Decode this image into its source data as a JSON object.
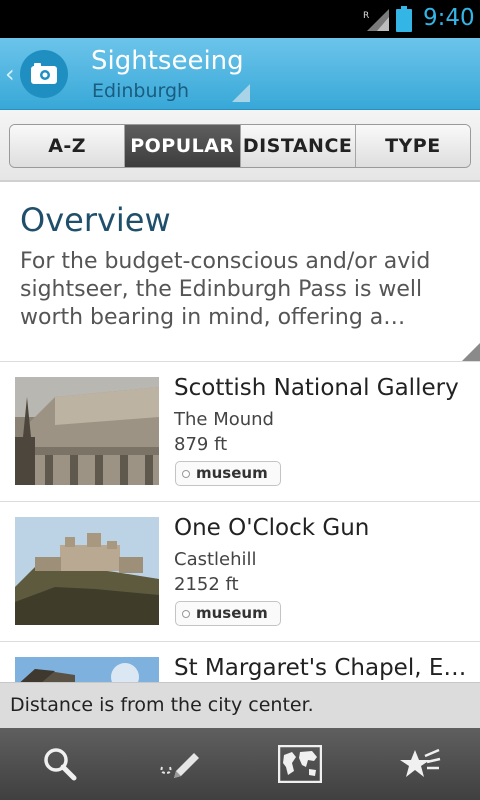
{
  "status_bar": {
    "time": "9:40",
    "signal_icon": "signal-roaming-icon",
    "battery_icon": "battery-icon"
  },
  "action_bar": {
    "title": "Sightseeing",
    "subtitle": "Edinburgh",
    "app_icon": "camera-icon",
    "accent_color": "#38a8d8"
  },
  "tabs": [
    {
      "label": "A-Z",
      "active": false
    },
    {
      "label": "POPULAR",
      "active": true
    },
    {
      "label": "DISTANCE",
      "active": false
    },
    {
      "label": "TYPE",
      "active": false
    }
  ],
  "overview": {
    "title": "Overview",
    "text": "For the budget-conscious and/or avid sightseer, the Edinburgh Pass is well worth bearing in mind, offering a…"
  },
  "items": [
    {
      "name": "Scottish National Gallery",
      "address": "The Mound",
      "distance": "879 ft",
      "tag": "museum"
    },
    {
      "name": "One O'Clock Gun",
      "address": "Castlehill",
      "distance": "2152 ft",
      "tag": "museum"
    },
    {
      "name": "St Margaret's Chapel, Edi…",
      "address": "",
      "distance": "",
      "tag": ""
    }
  ],
  "toast": {
    "text": "Distance is from the city center."
  },
  "bottom_bar": [
    {
      "icon": "search-icon"
    },
    {
      "icon": "pencil-icon"
    },
    {
      "icon": "map-icon"
    },
    {
      "icon": "favorites-star-icon"
    }
  ]
}
